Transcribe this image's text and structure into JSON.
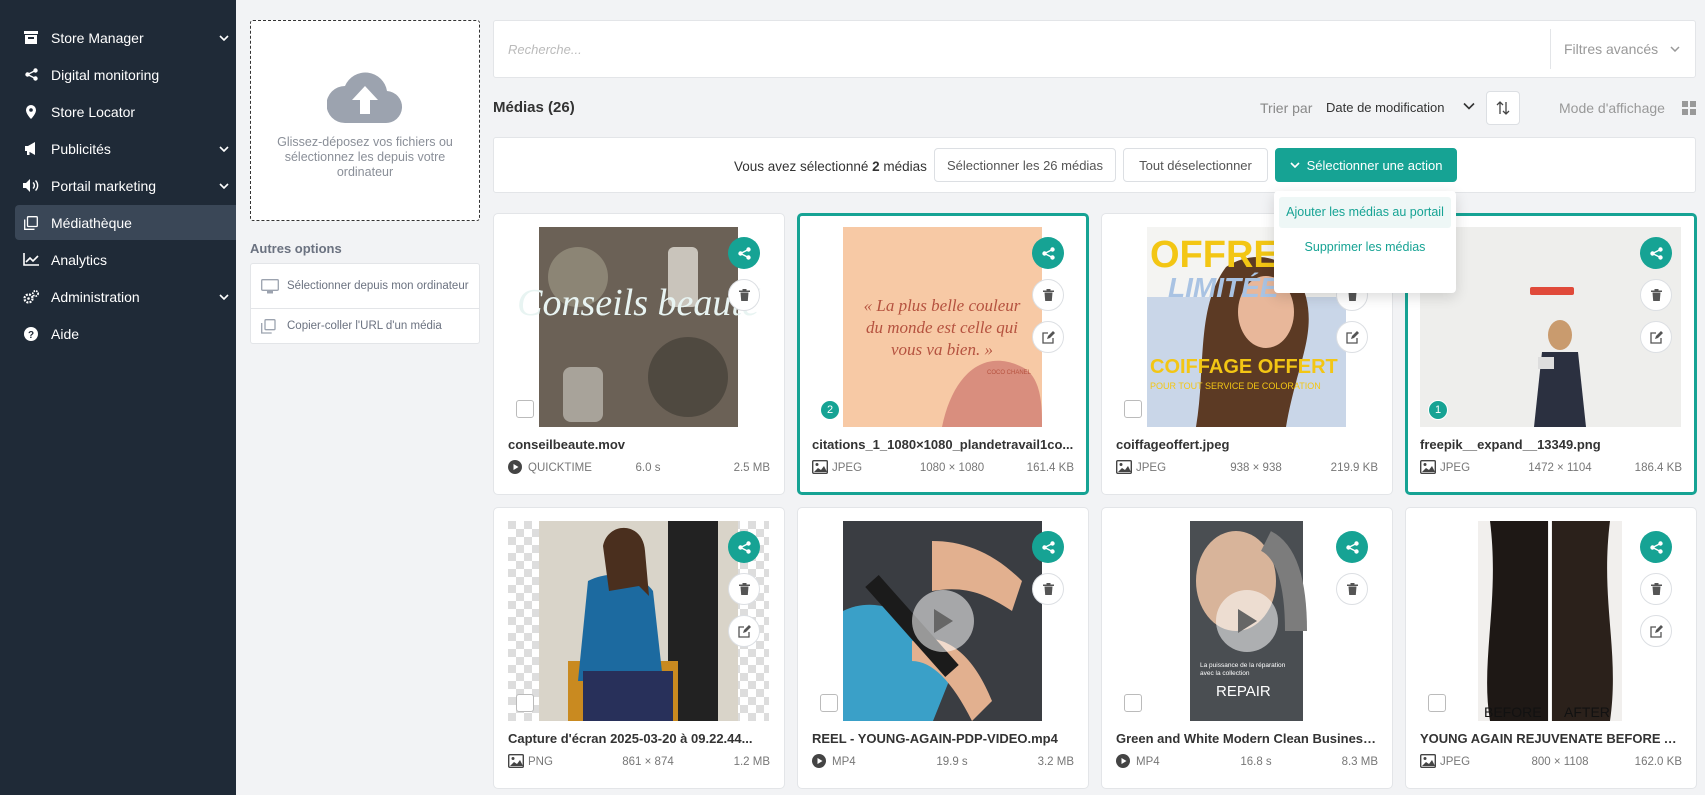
{
  "sidebar": {
    "items": [
      {
        "label": "Store Manager",
        "icon": "store-icon"
      },
      {
        "label": "Digital monitoring",
        "icon": "share-icon"
      },
      {
        "label": "Store Locator",
        "icon": "map-pin-icon"
      },
      {
        "label": "Publicités",
        "icon": "megaphone-icon"
      },
      {
        "label": "Portail marketing",
        "icon": "speaker-icon"
      },
      {
        "label": "Médiathèque",
        "icon": "media-library-icon"
      },
      {
        "label": "Analytics",
        "icon": "chart-line-icon"
      },
      {
        "label": "Administration",
        "icon": "cogs-icon"
      },
      {
        "label": "Aide",
        "icon": "help-icon"
      }
    ]
  },
  "upload": {
    "text": "Glissez-déposez vos fichiers ou sélectionnez les depuis votre ordinateur"
  },
  "options": {
    "title": "Autres options",
    "from_computer": "Sélectionner depuis mon ordinateur",
    "paste_url": "Copier-coller l'URL d'un média"
  },
  "search": {
    "placeholder": "Recherche...",
    "filters_label": "Filtres avancés"
  },
  "toolbar": {
    "media_title": "Médias (26)",
    "sort_label": "Trier par",
    "sort_value": "Date de modification",
    "view_mode_label": "Mode d'affichage"
  },
  "selection": {
    "prefix": "Vous avez sélectionné",
    "count": "2",
    "suffix": "médias",
    "select_all": "Sélectionner les 26 médias",
    "deselect_all": "Tout déselectionner",
    "action_label": "Sélectionner une action"
  },
  "dropdown": {
    "items": [
      "Ajouter les médias au portail",
      "Supprimer les médias"
    ]
  },
  "media": [
    {
      "name": "conseilbeaute.mov",
      "type": "QUICKTIME",
      "dim": "6.0 s",
      "size": "2.5 MB",
      "kind": "video",
      "selected": false,
      "thumb_text": "Conseils beauté"
    },
    {
      "name": "citations_1_1080×1080_plandetravail1co...",
      "type": "JPEG",
      "dim": "1080 × 1080",
      "size": "161.4 KB",
      "kind": "image",
      "selected": true,
      "order": "2",
      "thumb_text": "« La plus belle couleur du monde est celle qui vous va bien. »",
      "thumb_sub": "COCO CHANEL"
    },
    {
      "name": "coiffageoffert.jpeg",
      "type": "JPEG",
      "dim": "938 × 938",
      "size": "219.9 KB",
      "kind": "image",
      "selected": false,
      "thumb_text": "OFFRE",
      "thumb_text2": "LIMITÉE",
      "thumb_text3": "COIFFAGE OFFERT",
      "thumb_text4": "POUR TOUT SERVICE DE COLORATION"
    },
    {
      "name": "freepik__expand__13349.png",
      "type": "JPEG",
      "dim": "1472 × 1104",
      "size": "186.4 KB",
      "kind": "image",
      "selected": true,
      "order": "1"
    },
    {
      "name": "Capture d'écran 2025-03-20 à 09.22.44...",
      "type": "PNG",
      "dim": "861 × 874",
      "size": "1.2 MB",
      "kind": "image",
      "selected": false
    },
    {
      "name": "REEL - YOUNG-AGAIN-PDP-VIDEO.mp4",
      "type": "MP4",
      "dim": "19.9 s",
      "size": "3.2 MB",
      "kind": "video",
      "selected": false
    },
    {
      "name": "Green and White Modern Clean Business...",
      "type": "MP4",
      "dim": "16.8 s",
      "size": "8.3 MB",
      "kind": "video",
      "selected": false,
      "thumb_text": "La puissance de la réparation avec la collection",
      "thumb_text2": "REPAIR"
    },
    {
      "name": "YOUNG AGAIN REJUVENATE BEFORE AF...",
      "type": "JPEG",
      "dim": "800 × 1108",
      "size": "162.0 KB",
      "kind": "image",
      "selected": false,
      "thumb_text": "BEFORE",
      "thumb_text2": "AFTER"
    }
  ],
  "colors": {
    "sidebar_bg": "#1f2a37",
    "accent": "#16a394",
    "page_bg": "#f2f3f5"
  }
}
